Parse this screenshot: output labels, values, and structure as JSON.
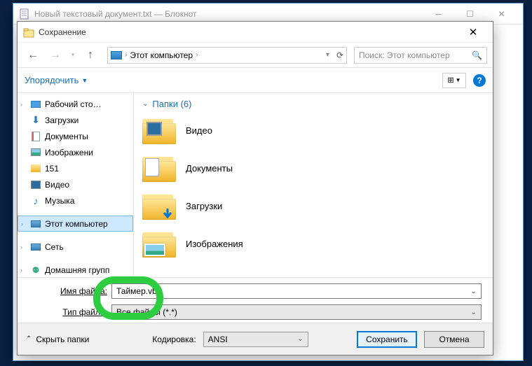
{
  "notepad": {
    "title": "Новый текстовый документ.txt — Блокнот"
  },
  "dialog": {
    "title": "Сохранение",
    "breadcrumb": {
      "location": "Этот компьютер"
    },
    "search_placeholder": "Поиск: Этот компьютер",
    "organize_label": "Упорядочить",
    "tree": {
      "items": [
        {
          "label": "Рабочий сто…",
          "icon": "desktop",
          "expand": ""
        },
        {
          "label": "Загрузки",
          "icon": "download",
          "expand": ""
        },
        {
          "label": "Документы",
          "icon": "document",
          "expand": ""
        },
        {
          "label": "Изображени",
          "icon": "image",
          "expand": ""
        },
        {
          "label": "151",
          "icon": "folder",
          "expand": ""
        },
        {
          "label": "Видео",
          "icon": "video",
          "expand": ""
        },
        {
          "label": "Музыка",
          "icon": "music",
          "expand": ""
        }
      ],
      "this_pc": "Этот компьютер",
      "network": "Сеть",
      "homegroup": "Домашняя групп"
    },
    "content": {
      "header": "Папки (6)",
      "folders": [
        {
          "label": "Видео",
          "overlay": "video"
        },
        {
          "label": "Документы",
          "overlay": "doc"
        },
        {
          "label": "Загрузки",
          "overlay": "download"
        },
        {
          "label": "Изображения",
          "overlay": "image"
        }
      ]
    },
    "filename_label_pre": "Имя фай",
    "filename_label_u": "л",
    "filename_label_post": "а:",
    "filename_value": "Таймер.vbs",
    "filetype_label_pre": "Тип фай",
    "filetype_label_u": "л",
    "filetype_label_post": "а:",
    "filetype_value": "Все файлы  (*.*)",
    "footer": {
      "hide_folders": "Скрыть папки",
      "encoding_label": "Кодировка:",
      "encoding_value": "ANSI",
      "save": "Сохранить",
      "cancel": "Отмена"
    }
  }
}
